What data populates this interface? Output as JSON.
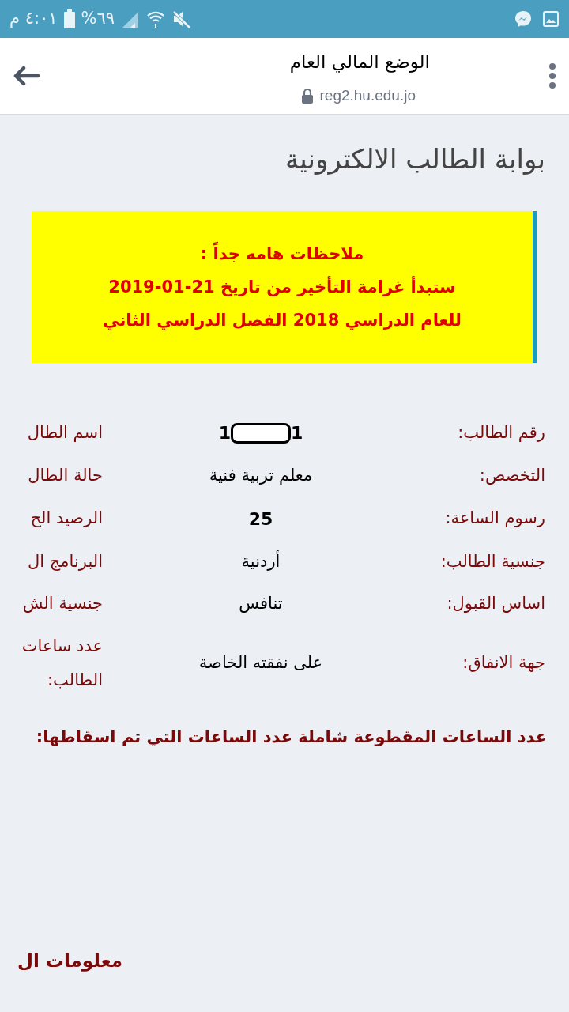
{
  "status_bar": {
    "time": "٤:٠١ م",
    "battery": "%٦٩"
  },
  "browser_bar": {
    "title": "الوضع المالي العام",
    "url": "reg2.hu.edu.jo"
  },
  "page": {
    "heading": "بوابة الطالب الالكترونية",
    "notice": [
      "ملاحظات هامه جداً :",
      "ستبدأ غرامة التأخير من تاريخ 21-01-2019",
      "للعام الدراسي 2018 الفصل الدراسي الثاني"
    ],
    "rows": [
      {
        "label": "رقم الطالب:",
        "kind": "redacted",
        "value_start": "1",
        "value_end": "1",
        "side_label": "اسم الطال"
      },
      {
        "label": "التخصص:",
        "kind": "text",
        "value": "معلم تربية فنية",
        "side_label": "حالة الطال"
      },
      {
        "label": "رسوم الساعة:",
        "kind": "number",
        "value": "25",
        "side_label": "الرصيد الح"
      },
      {
        "label": "جنسية الطالب:",
        "kind": "text",
        "value": "أردنية",
        "side_label": "البرنامج ال"
      },
      {
        "label": "اساس القبول:",
        "kind": "text",
        "value": "تنافس",
        "side_label": "جنسية الش"
      },
      {
        "label": "جهة الانفاق:",
        "kind": "text",
        "value": "على نفقته الخاصة",
        "side_label": "عدد ساعات",
        "side_label_2": "الطالب:"
      }
    ],
    "hours_label": "عدد الساعات المقطوعة شاملة عدد الساعات التي تم اسقاطها:",
    "section_heading": "معلومات ال"
  }
}
